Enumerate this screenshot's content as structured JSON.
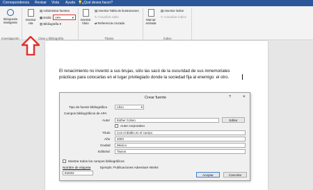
{
  "menubar": {
    "items": [
      "Correspondencia",
      "Revisar",
      "Vista",
      "Ayuda"
    ],
    "search": "¿Qué desea hacer?"
  },
  "ribbon": {
    "research": {
      "label": "Búsqueda\ninteligente",
      "group": "Investigación"
    },
    "citations": {
      "insert_citation": "Insertar\ncita",
      "manage_sources": "Administrar fuentes",
      "style_label": "Estilo:",
      "style_value": "APA",
      "bibliography": "Bibliografía",
      "group": "Citas y bibliografía"
    },
    "captions": {
      "insert_caption": "Insertar\ntítulo",
      "insert_table_of_figures": "Insertar Tabla de ilustraciones",
      "update_table": "Actualizar tabla",
      "cross_reference": "Referencia cruzada",
      "group": "Títulos"
    },
    "index": {
      "mark_entry": "Marcar\nentrada",
      "insert_index": "Insertar índice",
      "update_index": "Actualizar índice",
      "group": "Índice"
    }
  },
  "document": {
    "line1": "El renacimiento no inventó a sus brujas, sólo las sacó de la oscuridad de sus inmemoriales",
    "line2": "prácticas para colocarlas en el lugar privilegiado donde la sociedad fija al enemigo: el otro."
  },
  "dialog": {
    "title": "Crear fuente",
    "help": "?",
    "close": "×",
    "source_type_label": "Tipo de fuente bibliográfica",
    "source_type_value": "Libro",
    "fields_heading": "Campos bibliográficos de APA",
    "author_label": "Autor",
    "author_value": "Esther Cohen",
    "edit_button": "Editar",
    "corporate_author": "Autor corporativo",
    "title_label": "Título",
    "title_value": "Con el diablo en el cuerpo",
    "year_label": "Año",
    "year_value": "2003",
    "city_label": "Ciudad",
    "city_value": "Mexico",
    "publisher_label": "Editorial",
    "publisher_value": "Taurus",
    "show_all": "Mostrar todos los campos bibliográficos",
    "tag_label": "Nombre de etiqueta",
    "tag_value": "Est032",
    "example": "Ejemplo: Publicaciones Adventure Works",
    "ok": "Aceptar",
    "cancel": "Cancelar"
  },
  "colors": {
    "titlebar": "#2b579a",
    "highlight": "#e0302e"
  }
}
